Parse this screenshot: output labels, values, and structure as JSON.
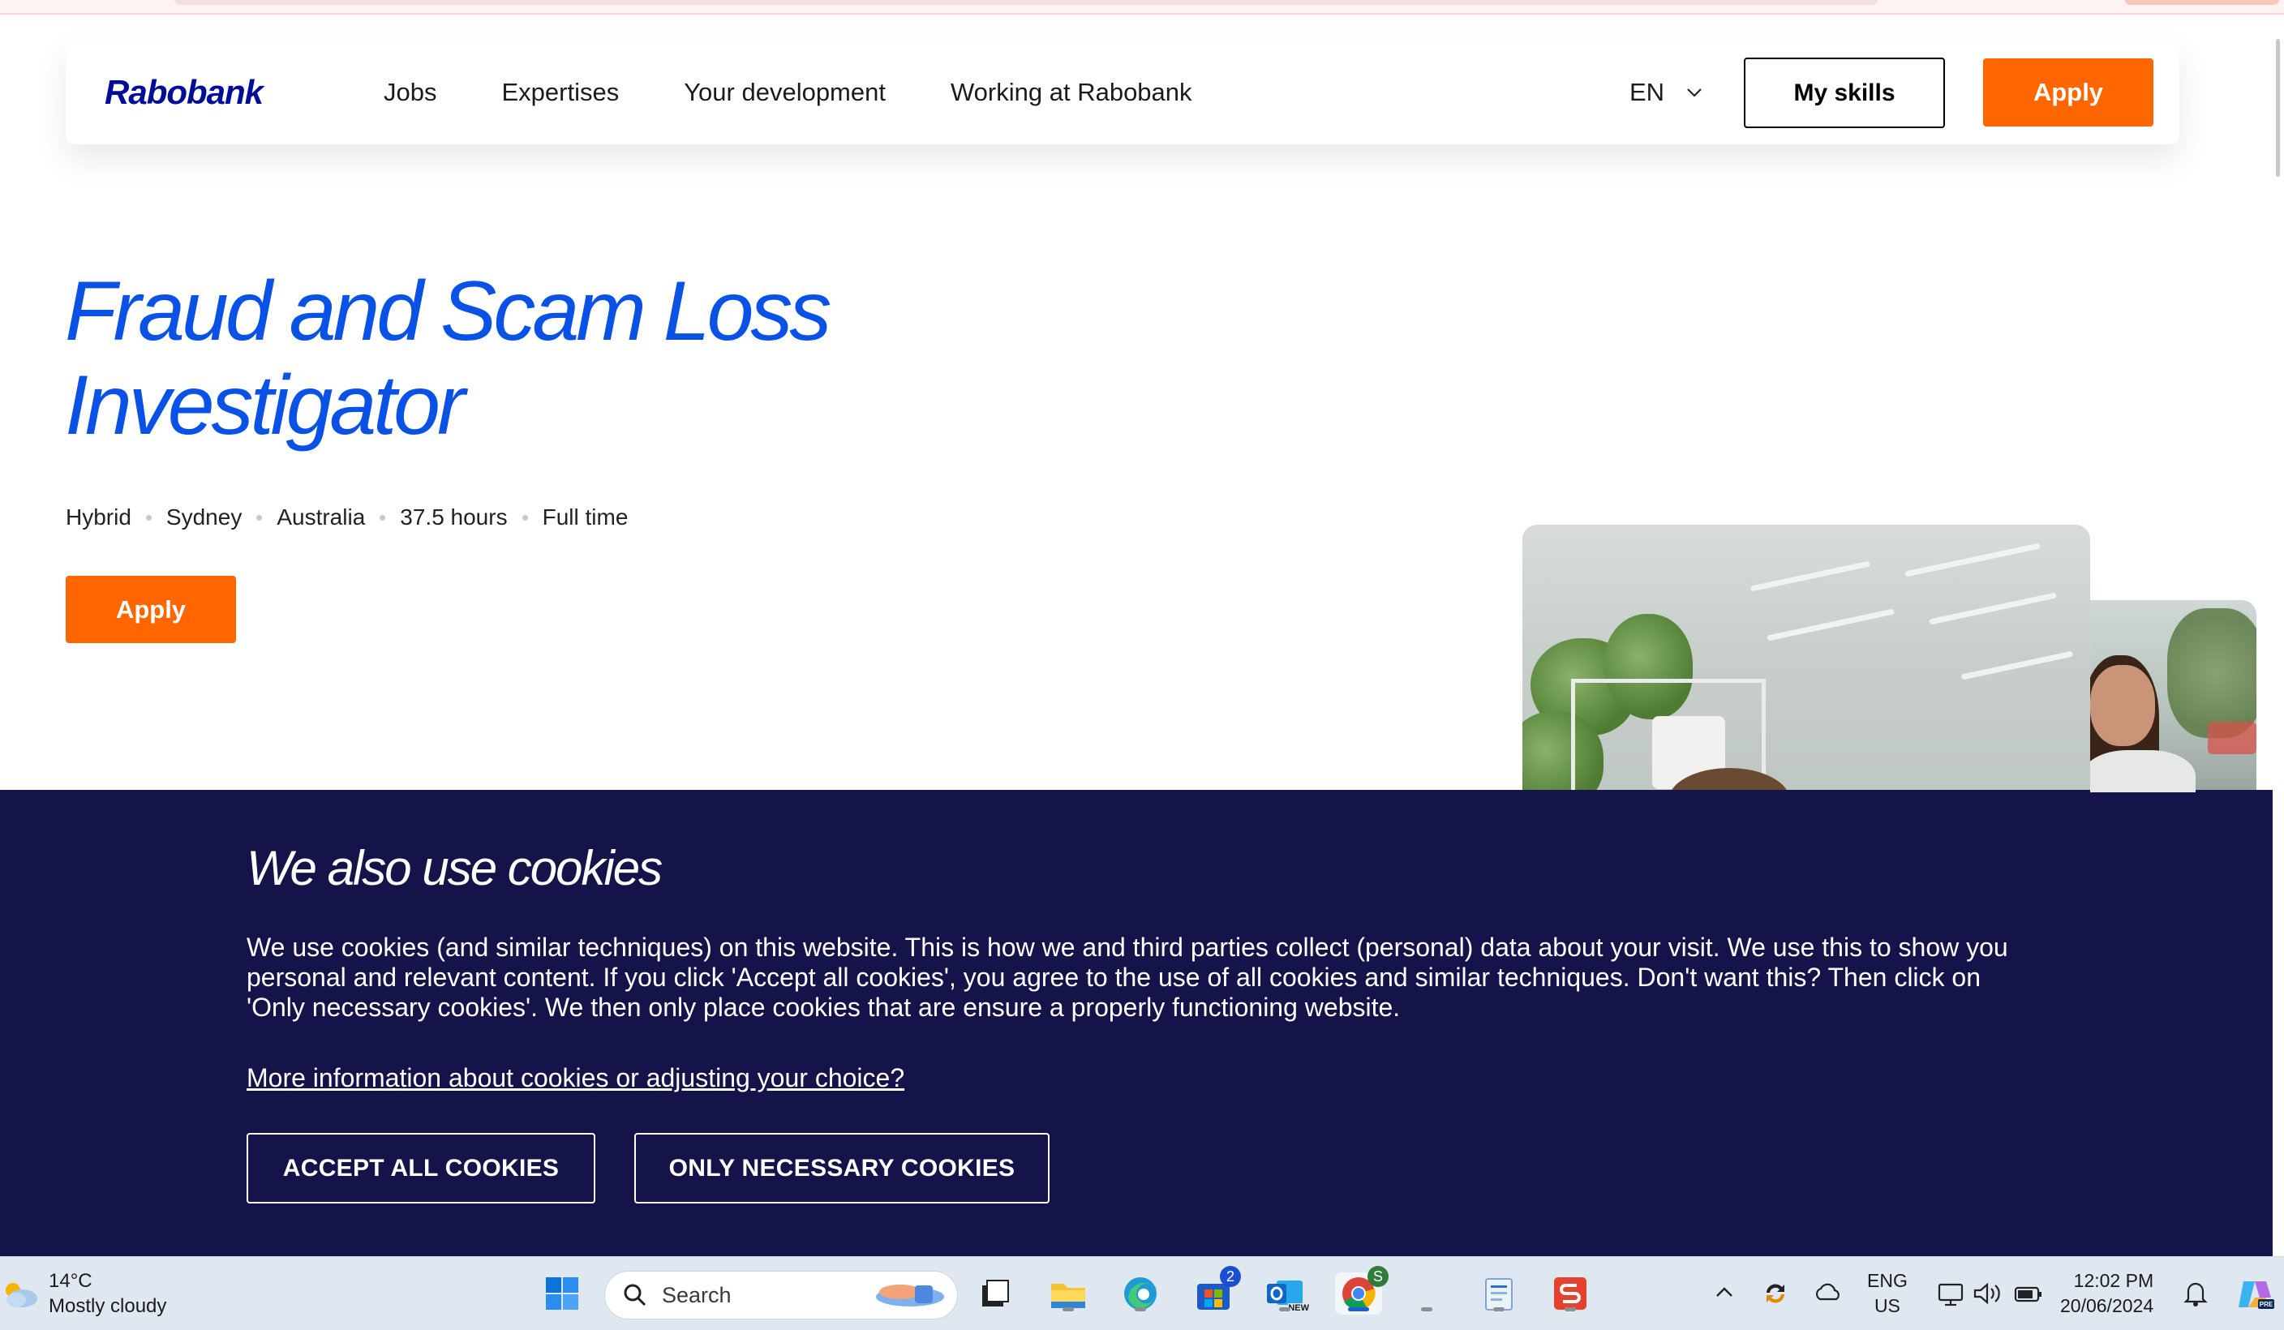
{
  "nav": {
    "logo": "Rabobank",
    "links": [
      "Jobs",
      "Expertises",
      "Your development",
      "Working at Rabobank"
    ],
    "language": "EN",
    "my_skills": "My skills",
    "apply": "Apply"
  },
  "hero": {
    "title": "Fraud and Scam Loss Investigator",
    "meta": [
      "Hybrid",
      "Sydney",
      "Australia",
      "37.5 hours",
      "Full time"
    ],
    "apply": "Apply"
  },
  "cookie": {
    "title": "We also use cookies",
    "text": "We use cookies (and similar techniques) on this website. This is how we and third parties collect (personal) data about your visit. We use this to show you personal and relevant content. If you click 'Accept all cookies', you agree to the use of all cookies and similar techniques. Don't want this? Then click on 'Only necessary cookies'. We then only place cookies that are ensure a properly functioning website.",
    "link": "More information about cookies or adjusting your choice?",
    "accept": "ACCEPT ALL COOKIES",
    "necessary": "ONLY NECESSARY COOKIES"
  },
  "taskbar": {
    "weather_temp": "14°C",
    "weather_desc": "Mostly cloudy",
    "search_placeholder": "Search",
    "store_badge": "2",
    "chrome_badge": "S",
    "outlook_tag": "NEW",
    "lang_top": "ENG",
    "lang_bottom": "US",
    "time": "12:02 PM",
    "date": "20/06/2024",
    "icons": [
      "windows-start-icon",
      "search-icon",
      "task-view-icon",
      "file-explorer-icon",
      "edge-icon",
      "microsoft-store-icon",
      "outlook-icon",
      "chrome-icon",
      "notepad-icon",
      "app-s-icon",
      "chevron-up-icon",
      "sync-icon",
      "onedrive-icon",
      "display-icon",
      "volume-icon",
      "battery-icon",
      "notification-icon",
      "copilot-icon"
    ]
  },
  "colors": {
    "brand_blue": "#000d99",
    "title_blue": "#0a52e6",
    "accent_orange": "#ff6600",
    "cookie_bg": "#15144a"
  }
}
